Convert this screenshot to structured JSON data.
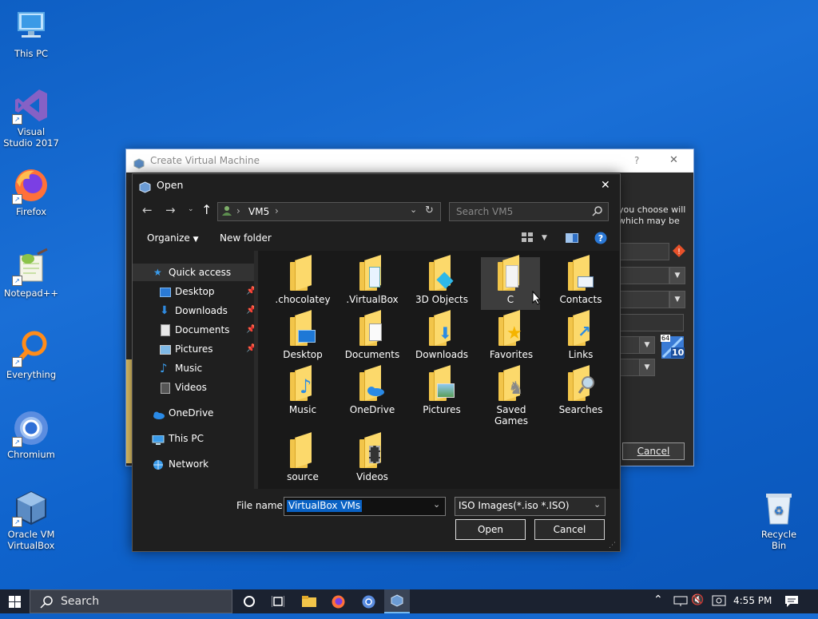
{
  "desktop": {
    "icons": [
      {
        "label": "This PC"
      },
      {
        "label": "Visual Studio 2017"
      },
      {
        "label": "Firefox"
      },
      {
        "label": "Notepad++"
      },
      {
        "label": "Everything"
      },
      {
        "label": "Chromium"
      },
      {
        "label": "Oracle VM VirtualBox"
      }
    ],
    "recycle_bin": "Recycle Bin"
  },
  "create_vm": {
    "title": "Create Virtual Machine",
    "help": "?",
    "close": "✕",
    "text_line1": "you choose will",
    "text_line2": "which may be",
    "cancel": "Cancel",
    "badge": "10",
    "badge_small": "64"
  },
  "open_dialog": {
    "title": "Open",
    "close": "✕",
    "address": {
      "path": "VM5",
      "sep": "›"
    },
    "search_placeholder": "Search VM5",
    "toolbar": {
      "organize": "Organize",
      "new_folder": "New folder"
    },
    "nav": [
      {
        "label": "Quick access",
        "pinned": false
      },
      {
        "label": "Desktop",
        "pinned": true
      },
      {
        "label": "Downloads",
        "pinned": true
      },
      {
        "label": "Documents",
        "pinned": true
      },
      {
        "label": "Pictures",
        "pinned": true
      },
      {
        "label": "Music",
        "pinned": false
      },
      {
        "label": "Videos",
        "pinned": false
      },
      {
        "label": "OneDrive",
        "pinned": false
      },
      {
        "label": "This PC",
        "pinned": false
      },
      {
        "label": "Network",
        "pinned": false
      }
    ],
    "pin_glyph": "📌",
    "items": [
      {
        "label": ".chocolatey"
      },
      {
        "label": ".VirtualBox"
      },
      {
        "label": "3D Objects"
      },
      {
        "label": "C"
      },
      {
        "label": "Contacts"
      },
      {
        "label": "Desktop"
      },
      {
        "label": "Documents"
      },
      {
        "label": "Downloads"
      },
      {
        "label": "Favorites"
      },
      {
        "label": "Links"
      },
      {
        "label": "Music"
      },
      {
        "label": "OneDrive"
      },
      {
        "label": "Pictures"
      },
      {
        "label": "Saved Games"
      },
      {
        "label": "Searches"
      },
      {
        "label": "source"
      },
      {
        "label": "Videos"
      }
    ],
    "file_name_label": "File name:",
    "file_name_value": "VirtualBox VMs",
    "file_type": "ISO Images(*.iso *.ISO)",
    "open_button": "Open",
    "cancel_button": "Cancel"
  },
  "taskbar": {
    "search": "Search",
    "time": "4:55 PM"
  },
  "colors": {
    "accent": "#0078d7",
    "folder": "#fcd96b",
    "dialog_bg": "#1f1f1f",
    "selection": "#0a62c4"
  }
}
